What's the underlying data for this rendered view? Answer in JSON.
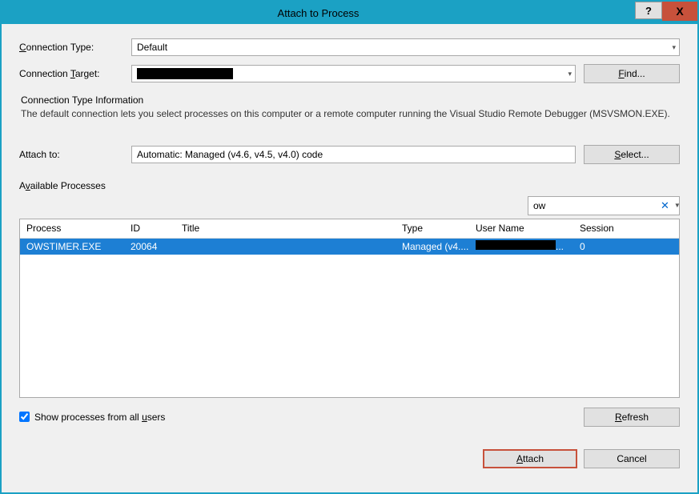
{
  "window": {
    "title": "Attach to Process",
    "help_symbol": "?",
    "close_symbol": "X"
  },
  "labels": {
    "connection_type": "Connection Type:",
    "connection_type_underline": "C",
    "connection_target": "Connection Target:",
    "connection_target_underline": "T",
    "attach_to": "Attach to:",
    "available_processes": "Available Processes",
    "available_processes_underline": "v",
    "show_all_users": "Show processes from all users",
    "show_all_users_underline": "u"
  },
  "fields": {
    "connection_type_value": "Default",
    "connection_target_value": "",
    "attach_to_value": "Automatic: Managed (v4.6, v4.5, v4.0) code",
    "filter_value": "ow"
  },
  "buttons": {
    "find": "Find...",
    "select": "Select...",
    "refresh": "Refresh",
    "attach": "Attach",
    "cancel": "Cancel"
  },
  "info": {
    "title": "Connection Type Information",
    "text": "The default connection lets you select processes on this computer or a remote computer running the Visual Studio Remote Debugger (MSVSMON.EXE)."
  },
  "table": {
    "headers": {
      "process": "Process",
      "id": "ID",
      "title": "Title",
      "type": "Type",
      "user_name": "User Name",
      "session": "Session"
    },
    "rows": [
      {
        "process": "OWSTIMER.EXE",
        "id": "20064",
        "title": "",
        "type": "Managed (v4....",
        "user_name": "",
        "session": "0"
      }
    ]
  },
  "checkbox": {
    "show_all_users_checked": true
  }
}
